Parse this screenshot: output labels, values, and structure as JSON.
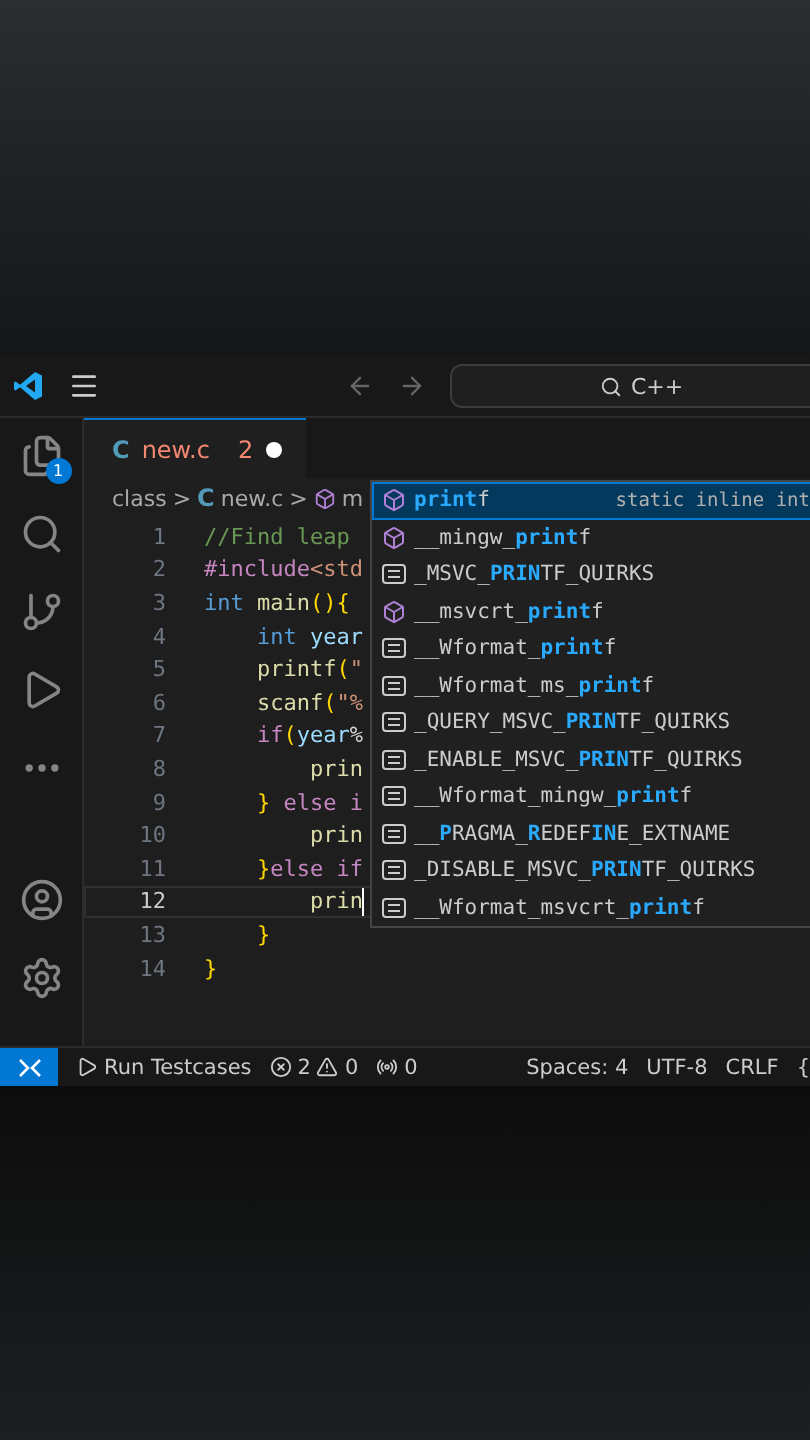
{
  "title_bar": {
    "search": "C++"
  },
  "activity_bar": {
    "items": [
      {
        "kind": "explorer",
        "badge": "1",
        "selected": false
      },
      {
        "kind": "search",
        "selected": false
      },
      {
        "kind": "source-control",
        "selected": false
      },
      {
        "kind": "run",
        "selected": false
      },
      {
        "kind": "more",
        "selected": false
      }
    ],
    "bottom": [
      {
        "kind": "account"
      },
      {
        "kind": "settings"
      }
    ]
  },
  "tabs": [
    {
      "icon": "C",
      "label": "new.c",
      "problems": "2",
      "modified": true,
      "selected": true
    }
  ],
  "breadcrumb": [
    {
      "kind": "folder",
      "text": "class"
    },
    {
      "kind": "file",
      "separator": ">",
      "icon": "C",
      "text": "new.c"
    },
    {
      "kind": "symbol",
      "separator": ">",
      "text": "m"
    }
  ],
  "code": {
    "lines": [
      {
        "number": "1",
        "current": false,
        "tokens": [
          {
            "kind": "comment",
            "text": "//Find leap"
          }
        ]
      },
      {
        "number": "2",
        "current": false,
        "tokens": [
          {
            "kind": "keyword",
            "text": "#include"
          },
          {
            "kind": "string",
            "text": "<std"
          }
        ]
      },
      {
        "number": "3",
        "current": false,
        "tokens": [
          {
            "kind": "type",
            "text": "int"
          },
          {
            "kind": "function",
            "text": " main"
          },
          {
            "kind": "brace",
            "text": "(){"
          }
        ]
      },
      {
        "number": "4",
        "current": false,
        "tokens": [
          {
            "kind": "type",
            "text": "    int"
          },
          {
            "kind": "variable",
            "text": " year"
          }
        ]
      },
      {
        "number": "5",
        "current": false,
        "tokens": [
          {
            "kind": "function",
            "text": "    printf"
          },
          {
            "kind": "brace",
            "text": "("
          },
          {
            "kind": "string",
            "text": "\""
          }
        ]
      },
      {
        "number": "6",
        "current": false,
        "tokens": [
          {
            "kind": "function",
            "text": "    scanf"
          },
          {
            "kind": "brace",
            "text": "("
          },
          {
            "kind": "string",
            "text": "\"%"
          }
        ]
      },
      {
        "number": "7",
        "current": false,
        "tokens": [
          {
            "kind": "keyword",
            "text": "    if"
          },
          {
            "kind": "brace",
            "text": "("
          },
          {
            "kind": "variable",
            "text": "year"
          },
          {
            "kind": "plain",
            "text": "%"
          }
        ]
      },
      {
        "number": "8",
        "current": false,
        "tokens": [
          {
            "kind": "function",
            "text": "        prin"
          }
        ]
      },
      {
        "number": "9",
        "current": false,
        "tokens": [
          {
            "kind": "brace",
            "text": "    }"
          },
          {
            "kind": "keyword",
            "text": " else i"
          }
        ]
      },
      {
        "number": "10",
        "current": false,
        "tokens": [
          {
            "kind": "function",
            "text": "        prin"
          }
        ]
      },
      {
        "number": "11",
        "current": false,
        "tokens": [
          {
            "kind": "brace",
            "text": "    }"
          },
          {
            "kind": "keyword",
            "text": "else if"
          }
        ]
      },
      {
        "number": "12",
        "current": true,
        "tokens": [
          {
            "kind": "function",
            "text": "        prin"
          }
        ]
      },
      {
        "number": "13",
        "current": false,
        "tokens": [
          {
            "kind": "brace",
            "text": "    }"
          }
        ]
      },
      {
        "number": "14",
        "current": false,
        "tokens": [
          {
            "kind": "brace",
            "text": "}"
          }
        ]
      }
    ]
  },
  "suggestions": {
    "items": [
      {
        "kind": "function",
        "selected": true,
        "detail": "static inline int",
        "segments": [
          {
            "text": "print",
            "match": true
          },
          {
            "text": "f",
            "match": false
          }
        ]
      },
      {
        "kind": "function",
        "selected": false,
        "segments": [
          {
            "text": "__mingw_",
            "match": false
          },
          {
            "text": "print",
            "match": true
          },
          {
            "text": "f",
            "match": false
          }
        ]
      },
      {
        "kind": "macro",
        "selected": false,
        "segments": [
          {
            "text": "_MSVC_",
            "match": false
          },
          {
            "text": "PRIN",
            "match": true
          },
          {
            "text": "TF_QUIRKS",
            "match": false
          }
        ]
      },
      {
        "kind": "function",
        "selected": false,
        "segments": [
          {
            "text": "__msvcrt_",
            "match": false
          },
          {
            "text": "print",
            "match": true
          },
          {
            "text": "f",
            "match": false
          }
        ]
      },
      {
        "kind": "macro",
        "selected": false,
        "segments": [
          {
            "text": "__Wformat_",
            "match": false
          },
          {
            "text": "print",
            "match": true
          },
          {
            "text": "f",
            "match": false
          }
        ]
      },
      {
        "kind": "macro",
        "selected": false,
        "segments": [
          {
            "text": "__Wformat_ms_",
            "match": false
          },
          {
            "text": "print",
            "match": true
          },
          {
            "text": "f",
            "match": false
          }
        ]
      },
      {
        "kind": "macro",
        "selected": false,
        "segments": [
          {
            "text": "_QUERY_MSVC_",
            "match": false
          },
          {
            "text": "PRIN",
            "match": true
          },
          {
            "text": "TF_QUIRKS",
            "match": false
          }
        ]
      },
      {
        "kind": "macro",
        "selected": false,
        "segments": [
          {
            "text": "_ENABLE_MSVC_",
            "match": false
          },
          {
            "text": "PRIN",
            "match": true
          },
          {
            "text": "TF_QUIRKS",
            "match": false
          }
        ]
      },
      {
        "kind": "macro",
        "selected": false,
        "segments": [
          {
            "text": "__Wformat_mingw_",
            "match": false
          },
          {
            "text": "print",
            "match": true
          },
          {
            "text": "f",
            "match": false
          }
        ]
      },
      {
        "kind": "macro",
        "selected": false,
        "segments": [
          {
            "text": "__",
            "match": false
          },
          {
            "text": "P",
            "match": true
          },
          {
            "text": "RAGMA_",
            "match": false
          },
          {
            "text": "R",
            "match": true
          },
          {
            "text": "EDEF",
            "match": false
          },
          {
            "text": "IN",
            "match": true
          },
          {
            "text": "E_EXTNAME",
            "match": false
          }
        ]
      },
      {
        "kind": "macro",
        "selected": false,
        "segments": [
          {
            "text": "_DISABLE_MSVC_",
            "match": false
          },
          {
            "text": "PRIN",
            "match": true
          },
          {
            "text": "TF_QUIRKS",
            "match": false
          }
        ]
      },
      {
        "kind": "macro",
        "selected": false,
        "segments": [
          {
            "text": "__Wformat_msvcrt_",
            "match": false
          },
          {
            "text": "print",
            "match": true
          },
          {
            "text": "f",
            "match": false
          }
        ]
      }
    ]
  },
  "status_bar": {
    "run": "Run Testcases",
    "errors": "2",
    "warnings": "0",
    "ports": "0",
    "spaces": "Spaces: 4",
    "encoding": "UTF-8",
    "eol": "CRLF",
    "language": "{"
  }
}
